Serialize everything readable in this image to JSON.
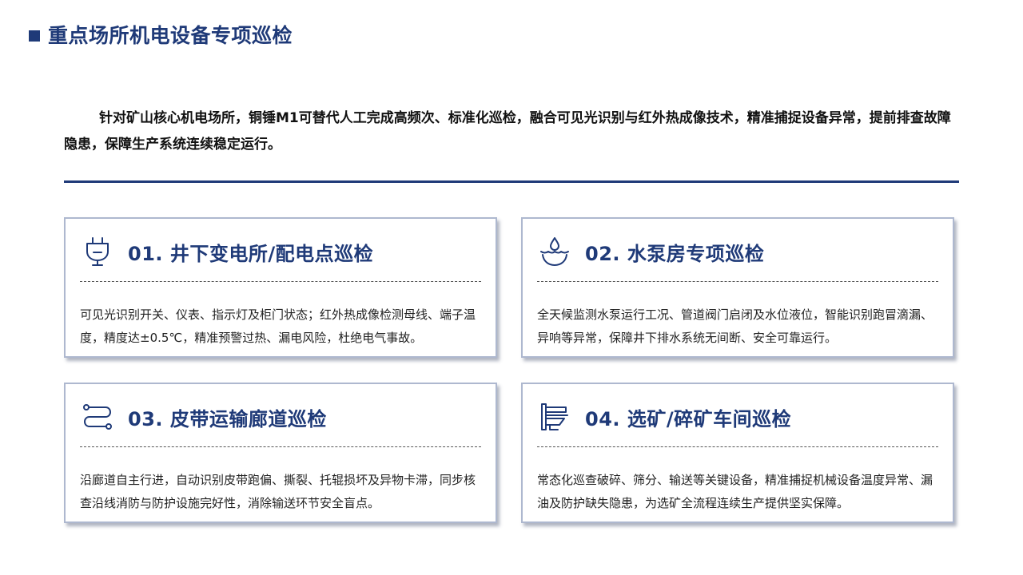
{
  "header": {
    "title": "重点场所机电设备专项巡检"
  },
  "intro": {
    "text": "针对矿山核心机电场所，铜锤M1可替代人工完成高频次、标准化巡检，融合可见光识别与红外热成像技术，精准捕捉设备异常，提前排查故障隐患，保障生产系统连续稳定运行。"
  },
  "colors": {
    "accent": "#1f3a78",
    "card_border": "#aeb8cf"
  },
  "cards": [
    {
      "icon": "plug-icon",
      "title": "01. 井下变电所/配电点巡检",
      "body": "可见光识别开关、仪表、指示灯及柜门状态；红外热成像检测母线、端子温度，精度达±0.5℃，精准预警过热、漏电风险，杜绝电气事故。"
    },
    {
      "icon": "water-drop-icon",
      "title": "02. 水泵房专项巡检",
      "body": "全天候监测水泵运行工况、管道阀门启闭及水位液位，智能识别跑冒滴漏、异响等异常，保障井下排水系统无间断、安全可靠运行。"
    },
    {
      "icon": "conveyor-path-icon",
      "title": "03. 皮带运输廊道巡检",
      "body": "沿廊道自主行进，自动识别皮带跑偏、撕裂、托辊损坏及异物卡滞，同步核查沿线消防与防护设施完好性，消除输送环节安全盲点。"
    },
    {
      "icon": "crusher-machine-icon",
      "title": "04. 选矿/碎矿车间巡检",
      "body": "常态化巡查破碎、筛分、输送等关键设备，精准捕捉机械设备温度异常、漏油及防护缺失隐患，为选矿全流程连续生产提供坚实保障。"
    }
  ]
}
